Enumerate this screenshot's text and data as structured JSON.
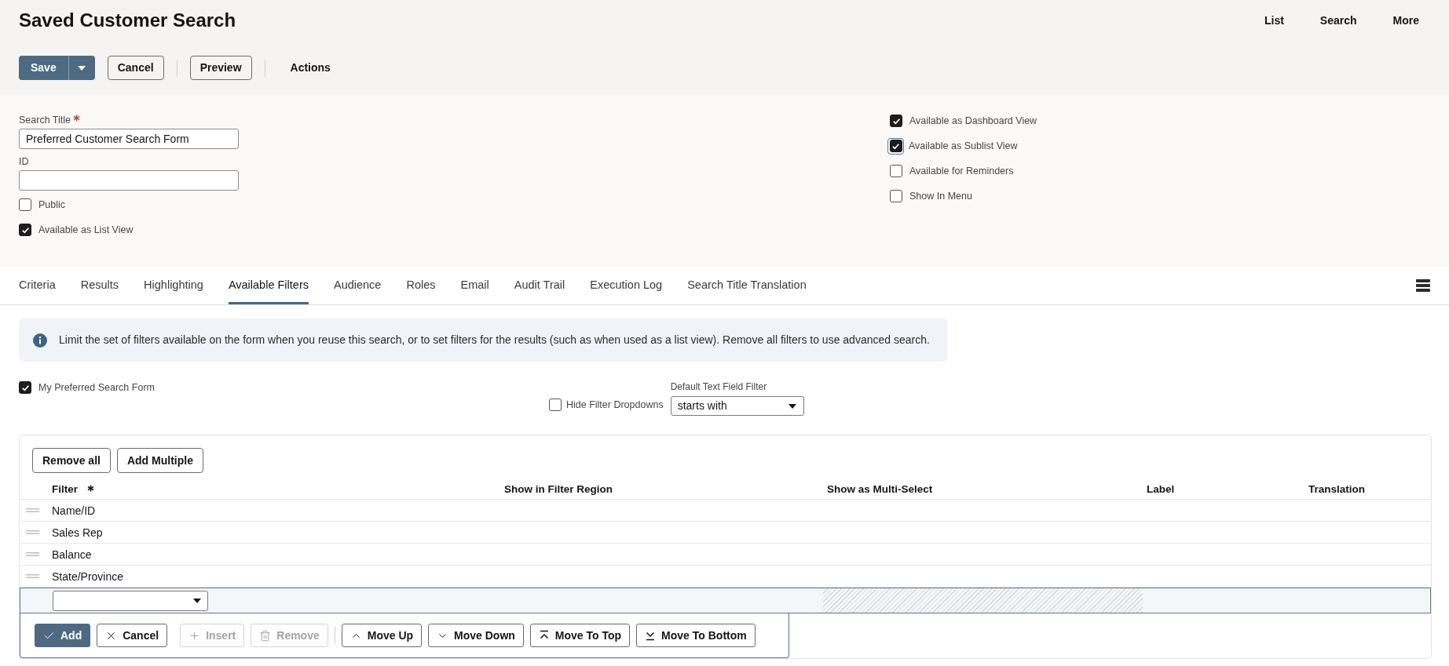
{
  "header": {
    "title": "Saved Customer Search",
    "nav": [
      {
        "label": "List"
      },
      {
        "label": "Search"
      },
      {
        "label": "More"
      }
    ]
  },
  "toolbar": {
    "groups": [
      [
        {
          "label": "Save",
          "kind": "split"
        },
        {
          "label": "Cancel",
          "kind": "outline"
        }
      ],
      [
        {
          "label": "Preview",
          "kind": "outline"
        }
      ],
      [
        {
          "label": "Actions",
          "kind": "text"
        }
      ]
    ]
  },
  "form": {
    "fields": [
      {
        "label": "Search Title",
        "required": true,
        "value": "Preferred Customer Search Form"
      },
      {
        "label": "ID",
        "required": false
      }
    ],
    "left_checkboxes": [
      {
        "label": "Public",
        "checked": false,
        "focused": false
      },
      {
        "label": "Available as List View",
        "checked": true,
        "focused": false
      }
    ],
    "right_checkboxes": [
      {
        "label": "Available as Dashboard View",
        "checked": true,
        "focused": false
      },
      {
        "label": "Available as Sublist View",
        "checked": true,
        "focused": true
      },
      {
        "label": "Available for Reminders",
        "checked": false,
        "focused": false
      },
      {
        "label": "Show In Menu",
        "checked": false,
        "focused": false
      }
    ]
  },
  "tabs": [
    {
      "label": "Criteria",
      "selected": false
    },
    {
      "label": "Results",
      "selected": false
    },
    {
      "label": "Highlighting",
      "selected": false
    },
    {
      "label": "Available Filters",
      "selected": true
    },
    {
      "label": "Audience",
      "selected": false
    },
    {
      "label": "Roles",
      "selected": false
    },
    {
      "label": "Email",
      "selected": false
    },
    {
      "label": "Audit Trail",
      "selected": false
    },
    {
      "label": "Execution Log",
      "selected": false
    },
    {
      "label": "Search Title Translation",
      "selected": false
    }
  ],
  "info": {
    "text": "Limit the set of filters available on the form when you reuse this search, or to set filters for the results (such as when used as a list view). Remove all filters to use advanced search."
  },
  "options": {
    "preferred": {
      "label": "My Preferred Search Form",
      "checked": true
    },
    "hide_dropdowns": {
      "label": "Hide Filter Dropdowns",
      "checked": false
    },
    "default_filter": {
      "label": "Default Text Field Filter",
      "value": "starts with"
    }
  },
  "filters_table": {
    "buttons": [
      "Remove all",
      "Add Multiple"
    ],
    "columns": [
      {
        "label": "Filter",
        "required": true
      },
      {
        "label": "Show in Filter Region",
        "required": false
      },
      {
        "label": "Show as Multi-Select",
        "required": false
      },
      {
        "label": "Label",
        "required": false
      },
      {
        "label": "Translation",
        "required": false
      }
    ],
    "rows": [
      {
        "filter": "Name/ID"
      },
      {
        "filter": "Sales Rep"
      },
      {
        "filter": "Balance"
      },
      {
        "filter": "State/Province"
      }
    ],
    "edit_row": {
      "multi_select_disabled": true
    },
    "action_groups": [
      {
        "separated": false,
        "buttons": [
          {
            "label": "Add",
            "kind": "add",
            "disabled": false
          },
          {
            "label": "Cancel",
            "kind": "cancel",
            "disabled": false
          }
        ]
      },
      {
        "separated": false,
        "buttons": [
          {
            "label": "Insert",
            "kind": "insert",
            "disabled": true
          },
          {
            "label": "Remove",
            "kind": "remove",
            "disabled": true
          }
        ]
      },
      {
        "separated": true,
        "buttons": [
          {
            "label": "Move Up",
            "kind": "move_up",
            "disabled": false
          },
          {
            "label": "Move Down",
            "kind": "move_down",
            "disabled": false
          },
          {
            "label": "Move To Top",
            "kind": "move_top",
            "disabled": false
          },
          {
            "label": "Move To Bottom",
            "kind": "move_bottom",
            "disabled": false
          }
        ]
      }
    ]
  }
}
